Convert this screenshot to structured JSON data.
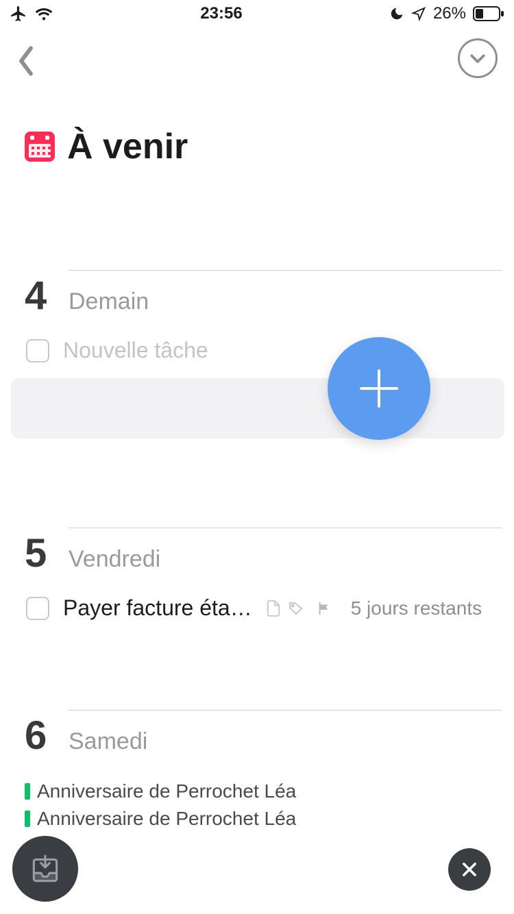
{
  "status": {
    "time": "23:56",
    "battery": "26%"
  },
  "page": {
    "title": "À venir"
  },
  "sections": [
    {
      "dayNum": "4",
      "dayName": "Demain",
      "newTaskPlaceholder": "Nouvelle tâche"
    },
    {
      "dayNum": "5",
      "dayName": "Vendredi",
      "task": {
        "title": "Payer facture éta…",
        "due": "5 jours restants"
      }
    },
    {
      "dayNum": "6",
      "dayName": "Samedi",
      "events": [
        "Anniversaire de Perrochet Léa",
        "Anniversaire de Perrochet Léa"
      ]
    }
  ]
}
